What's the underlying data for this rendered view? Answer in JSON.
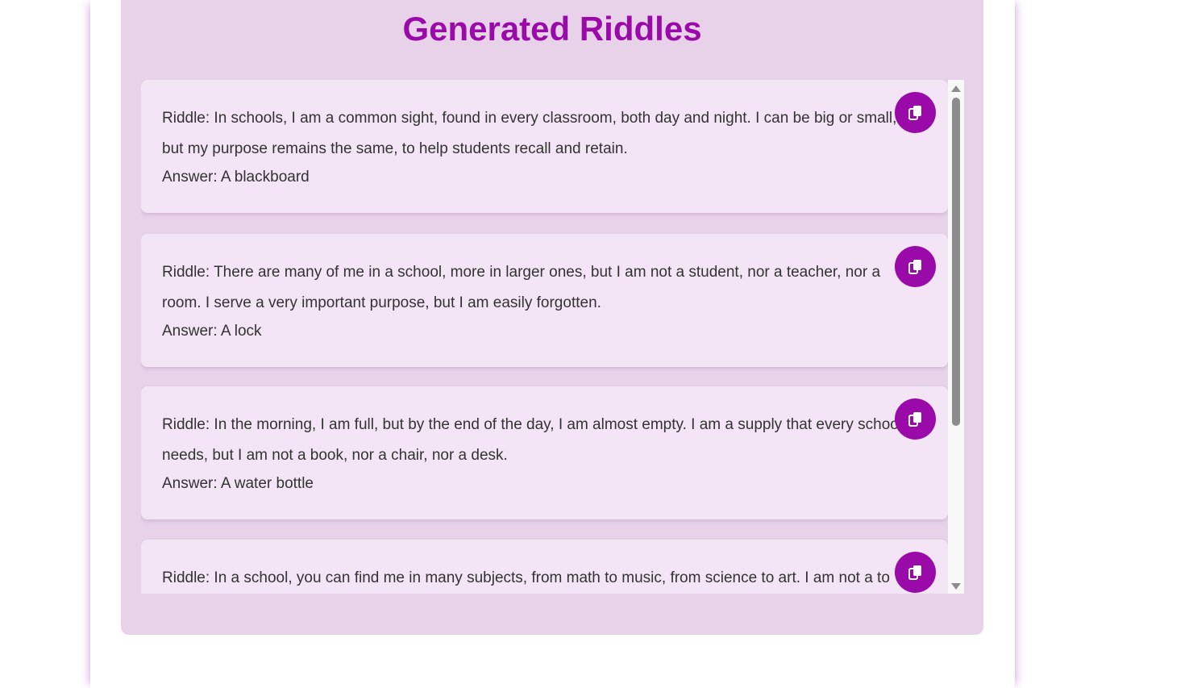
{
  "panel": {
    "title": "Generated Riddles"
  },
  "riddles": [
    {
      "riddle": "Riddle: In schools, I am a common sight, found in every classroom, both day and night. I can be big or small, but my purpose remains the same, to help students recall and retain.",
      "answer": "Answer: A blackboard"
    },
    {
      "riddle": "Riddle: There are many of me in a school, more in larger ones, but I am not a student, nor a teacher, nor a room. I serve a very important purpose, but I am easily forgotten.",
      "answer": "Answer: A lock"
    },
    {
      "riddle": "Riddle: In the morning, I am full, but by the end of the day, I am almost empty. I am a supply that every school needs, but I am not a book, nor a chair, nor a desk.",
      "answer": "Answer: A water bottle"
    },
    {
      "riddle": "Riddle: In a school, you can find me in many subjects, from math to music, from science to art. I am not a to",
      "answer": ""
    }
  ],
  "icons": {
    "copy": "copy-icon",
    "scroll_up": "scroll-up-arrow-icon",
    "scroll_down": "scroll-down-arrow-icon"
  },
  "colors": {
    "accent": "#9a0aa8",
    "panel_background": "#e7d2e9",
    "card_background": "#f3e5f5",
    "text": "#333333"
  },
  "scroll": {
    "position_fraction": 0.0,
    "visible_fraction": 0.65
  }
}
